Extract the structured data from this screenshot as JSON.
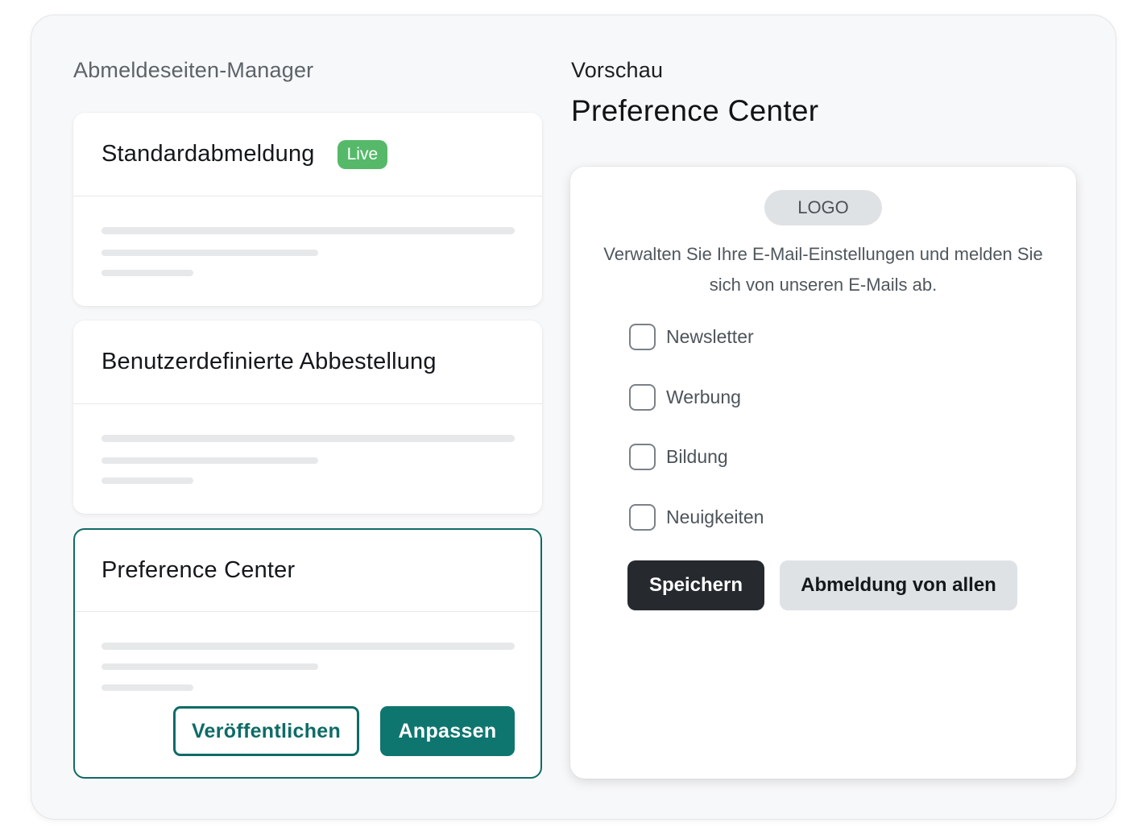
{
  "manager": {
    "label": "Abmeldeseiten-Manager",
    "cards": [
      {
        "title": "Standardabmeldung",
        "badge": "Live"
      },
      {
        "title": "Benutzerdefinierte Abbestellung"
      },
      {
        "title": "Preference Center",
        "publish_label": "Veröffentlichen",
        "customize_label": "Anpassen"
      }
    ]
  },
  "preview": {
    "label": "Vorschau",
    "title": "Preference Center",
    "logo": "LOGO",
    "description": "Verwalten Sie Ihre E-Mail-Einstellungen und melden Sie sich von unseren E-Mails ab.",
    "options": [
      "Newsletter",
      "Werbung",
      "Bildung",
      "Neuigkeiten"
    ],
    "save_label": "Speichern",
    "unsubscribe_all_label": "Abmeldung von allen"
  },
  "colors": {
    "accent": "#0e6b66",
    "live_badge": "#56b96a",
    "dark_button": "#262a2e"
  }
}
